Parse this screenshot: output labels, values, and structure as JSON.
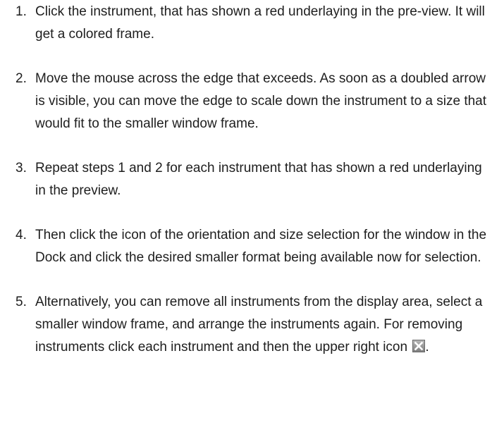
{
  "steps": [
    {
      "number": "1.",
      "text": "Click the instrument, that has shown a red underlaying in the pre-view. It will get a colored frame."
    },
    {
      "number": "2.",
      "text": "Move the mouse across the edge that exceeds. As soon as a doubled arrow is visible, you can move the edge to scale down the instrument to a size that would fit to the smaller window frame."
    },
    {
      "number": "3.",
      "text": "Repeat steps 1 and 2 for each instrument that has shown a red underlaying in the preview."
    },
    {
      "number": "4.",
      "text": "Then click the icon of the orientation and size selection for the window in the Dock and click the desired smaller format being available now for selection."
    },
    {
      "number": "5.",
      "text": "Alternatively, you can remove all instruments from the display area, select a smaller window frame, and arrange the instruments again. For removing instruments click each instrument and then the upper right icon ",
      "trailing_text": ".",
      "icon": "close-x-icon"
    }
  ]
}
